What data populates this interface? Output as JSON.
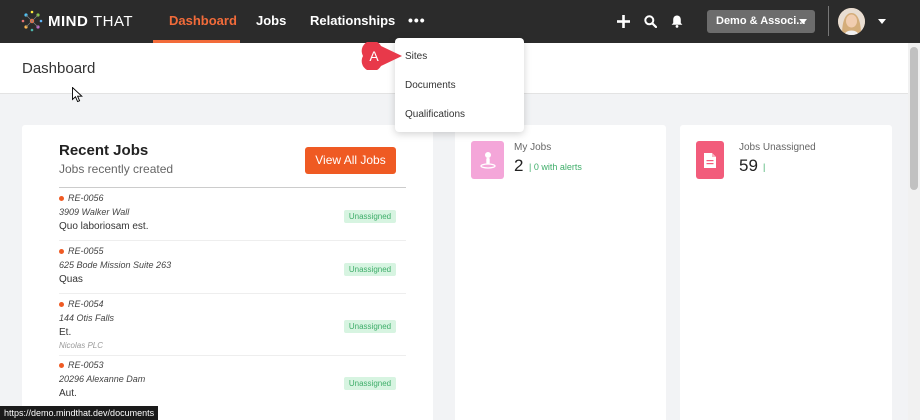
{
  "topbar": {
    "logo_bold": "MIND",
    "logo_thin": "THAT",
    "nav": [
      {
        "label": "Dashboard"
      },
      {
        "label": "Jobs"
      },
      {
        "label": "Relationships"
      }
    ],
    "more_label": "•••",
    "org_select": "Demo & Associ...",
    "icons": [
      "plus-icon",
      "search-icon",
      "bell-icon"
    ]
  },
  "page": {
    "title": "Dashboard"
  },
  "more_menu": {
    "items": [
      {
        "label": "Sites"
      },
      {
        "label": "Documents"
      },
      {
        "label": "Qualifications"
      }
    ]
  },
  "annotation": {
    "label": "A"
  },
  "recent_jobs": {
    "title": "Recent Jobs",
    "subtitle": "Jobs recently created",
    "view_all_label": "View All Jobs",
    "jobs": [
      {
        "id": "RE-0056",
        "address": "3909 Walker Wall",
        "name": "Quo laboriosam est.",
        "org": "",
        "status": "Unassigned"
      },
      {
        "id": "RE-0055",
        "address": "625 Bode Mission Suite 263",
        "name": "Quas",
        "org": "",
        "status": "Unassigned"
      },
      {
        "id": "RE-0054",
        "address": "144 Otis Falls",
        "name": "Et.",
        "org": "Nicolas PLC",
        "status": "Unassigned"
      },
      {
        "id": "RE-0053",
        "address": "20296 Alexanne Dam",
        "name": "Aut.",
        "org": "",
        "status": "Unassigned"
      }
    ]
  },
  "stats": {
    "my_jobs": {
      "label": "My Jobs",
      "value": "2",
      "alerts": "| 0 with alerts",
      "color": "#f4a6d9"
    },
    "jobs_unassigned": {
      "label": "Jobs Unassigned",
      "value": "59",
      "extra": "|",
      "color": "#f25c7b"
    }
  },
  "status_bar": {
    "url": "https://demo.mindthat.dev/documents"
  },
  "colors": {
    "accent": "#f26b3a",
    "button": "#ef5a23",
    "topbar": "#2b2b2b",
    "success": "#3fae6a"
  }
}
